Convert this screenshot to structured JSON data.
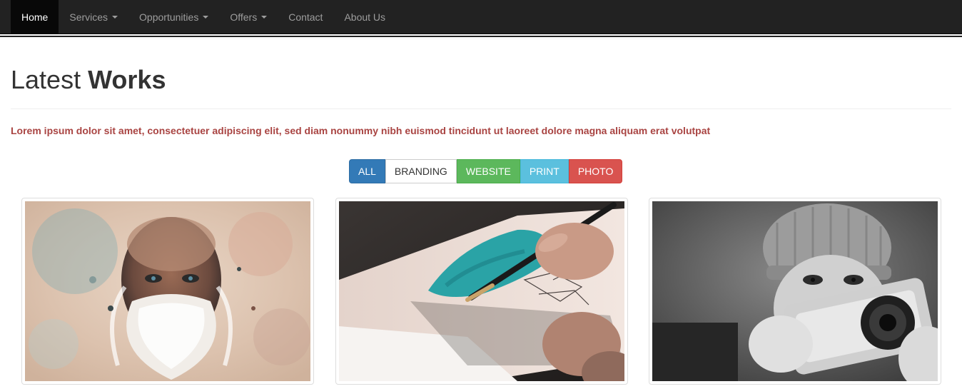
{
  "nav": {
    "items": [
      {
        "label": "Home",
        "active": true,
        "dropdown": false
      },
      {
        "label": "Services",
        "active": false,
        "dropdown": true
      },
      {
        "label": "Opportunities",
        "active": false,
        "dropdown": true
      },
      {
        "label": "Offers",
        "active": false,
        "dropdown": true
      },
      {
        "label": "Contact",
        "active": false,
        "dropdown": false
      },
      {
        "label": "About Us",
        "active": false,
        "dropdown": false
      }
    ]
  },
  "header": {
    "title_light": "Latest",
    "title_bold": "Works",
    "lead": "Lorem ipsum dolor sit amet, consectetuer adipiscing elit, sed diam nonummy nibh euismod tincidunt ut laoreet dolore magna aliquam erat volutpat"
  },
  "filters": [
    {
      "label": "ALL",
      "bg": "#337ab7",
      "fg": "#ffffff",
      "border": "#2e6da4"
    },
    {
      "label": "BRANDING",
      "bg": "#ffffff",
      "fg": "#333333",
      "border": "#cccccc"
    },
    {
      "label": "WEBSITE",
      "bg": "#5cb85c",
      "fg": "#ffffff",
      "border": "#4cae4c"
    },
    {
      "label": "PRINT",
      "bg": "#5bc0de",
      "fg": "#ffffff",
      "border": "#46b8da"
    },
    {
      "label": "PHOTO",
      "bg": "#d9534f",
      "fg": "#ffffff",
      "border": "#d43f3a"
    }
  ],
  "gallery": [
    {
      "subject": "watercolor-bearded-man-portrait"
    },
    {
      "subject": "hand-painting-watercolor"
    },
    {
      "subject": "woman-with-camera-bw"
    }
  ]
}
